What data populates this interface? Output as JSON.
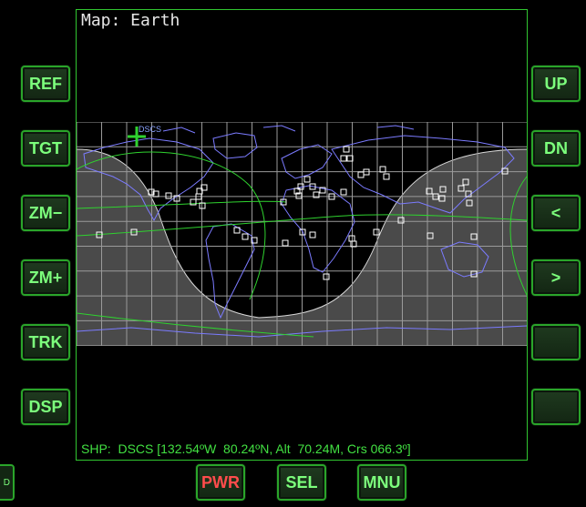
{
  "display": {
    "title": "Map: Earth",
    "status_line": "SHP:  DSCS [132.54ºW  80.24ºN, Alt  70.24M, Crs 066.3º]",
    "target_label": "DSCS"
  },
  "left_buttons": [
    "REF",
    "TGT",
    "ZM−",
    "ZM+",
    "TRK",
    "DSP"
  ],
  "right_buttons": [
    "UP",
    "DN",
    "<",
    ">",
    "",
    ""
  ],
  "bottom_buttons": [
    "PWR",
    "SEL",
    "MNU"
  ],
  "corner_stub_label": "D",
  "colors": {
    "grid": "#9a9a9a",
    "coastline": "#7b7bff",
    "orbit": "#2fd22f",
    "night_shade": "#4a4a4a",
    "button_text": "#7cff7c",
    "power_text": "#ff4c4c"
  }
}
